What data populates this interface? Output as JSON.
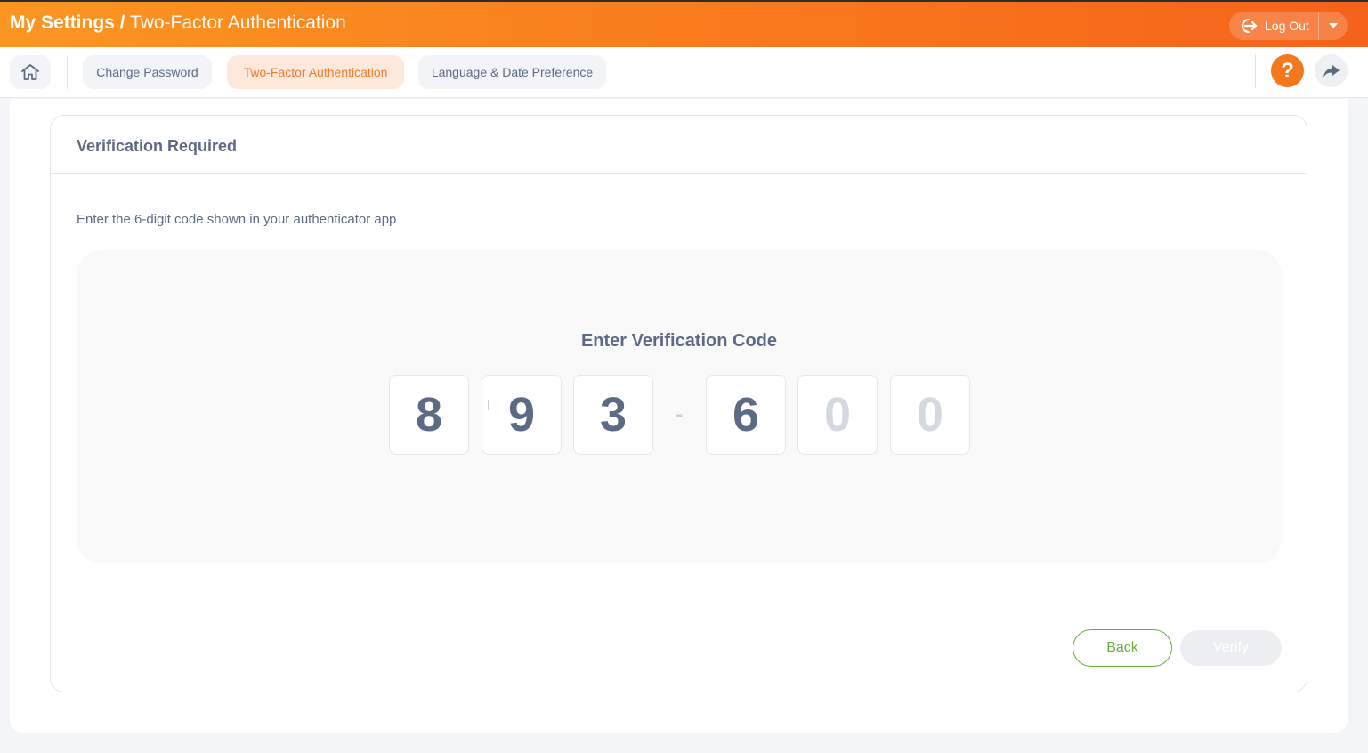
{
  "header": {
    "title_main": "My Settings /",
    "title_sub": "Two-Factor Authentication",
    "logout_label": "Log Out",
    "icons": {
      "logout": "logout-icon",
      "caret": "chevron-down-icon"
    }
  },
  "nav": {
    "tabs": [
      {
        "label": "Change Password"
      },
      {
        "label": "Two-Factor Authentication",
        "active": true
      },
      {
        "label": "Language & Date Preference"
      }
    ],
    "help_label": "?",
    "icons": {
      "home": "home-icon",
      "help": "help-icon",
      "share": "share-icon"
    }
  },
  "card": {
    "title": "Verification Required",
    "instruction": "Enter the 6-digit code shown in your authenticator app",
    "code_title": "Enter Verification Code",
    "digits": [
      "8",
      "9",
      "3",
      "6"
    ],
    "digit_placeholders": [
      "0",
      "0"
    ],
    "separator": "-",
    "back_label": "Back",
    "verify_label": "Verify"
  },
  "colors": {
    "accent": "#f5781c",
    "success": "#6aae3c",
    "text": "#5d6a84"
  }
}
